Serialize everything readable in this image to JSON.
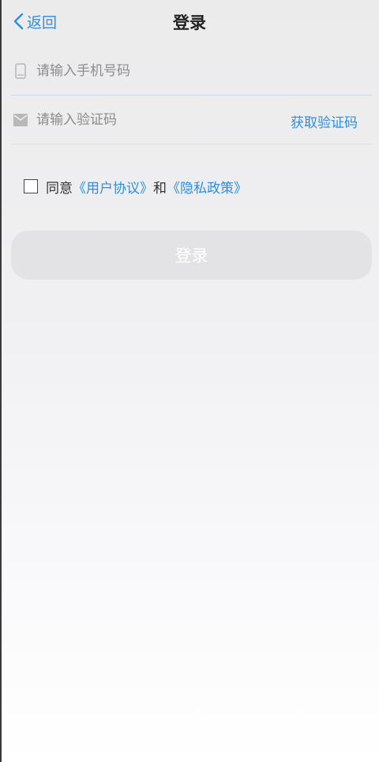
{
  "navbar": {
    "back_label": "返回",
    "title": "登录"
  },
  "form": {
    "phone_placeholder": "请输入手机号码",
    "code_placeholder": "请输入验证码",
    "get_code_label": "获取验证码"
  },
  "agreement": {
    "prefix": "同意",
    "user_agreement": "《用户协议》",
    "and": "和",
    "privacy_policy": "《隐私政策》",
    "checked": false
  },
  "login_button_label": "登录",
  "colors": {
    "accent": "#2a8fe0",
    "button_disabled": "#e3e3e5"
  },
  "icons": {
    "back": "chevron-left-icon",
    "phone": "phone-icon",
    "code": "envelope-icon"
  }
}
